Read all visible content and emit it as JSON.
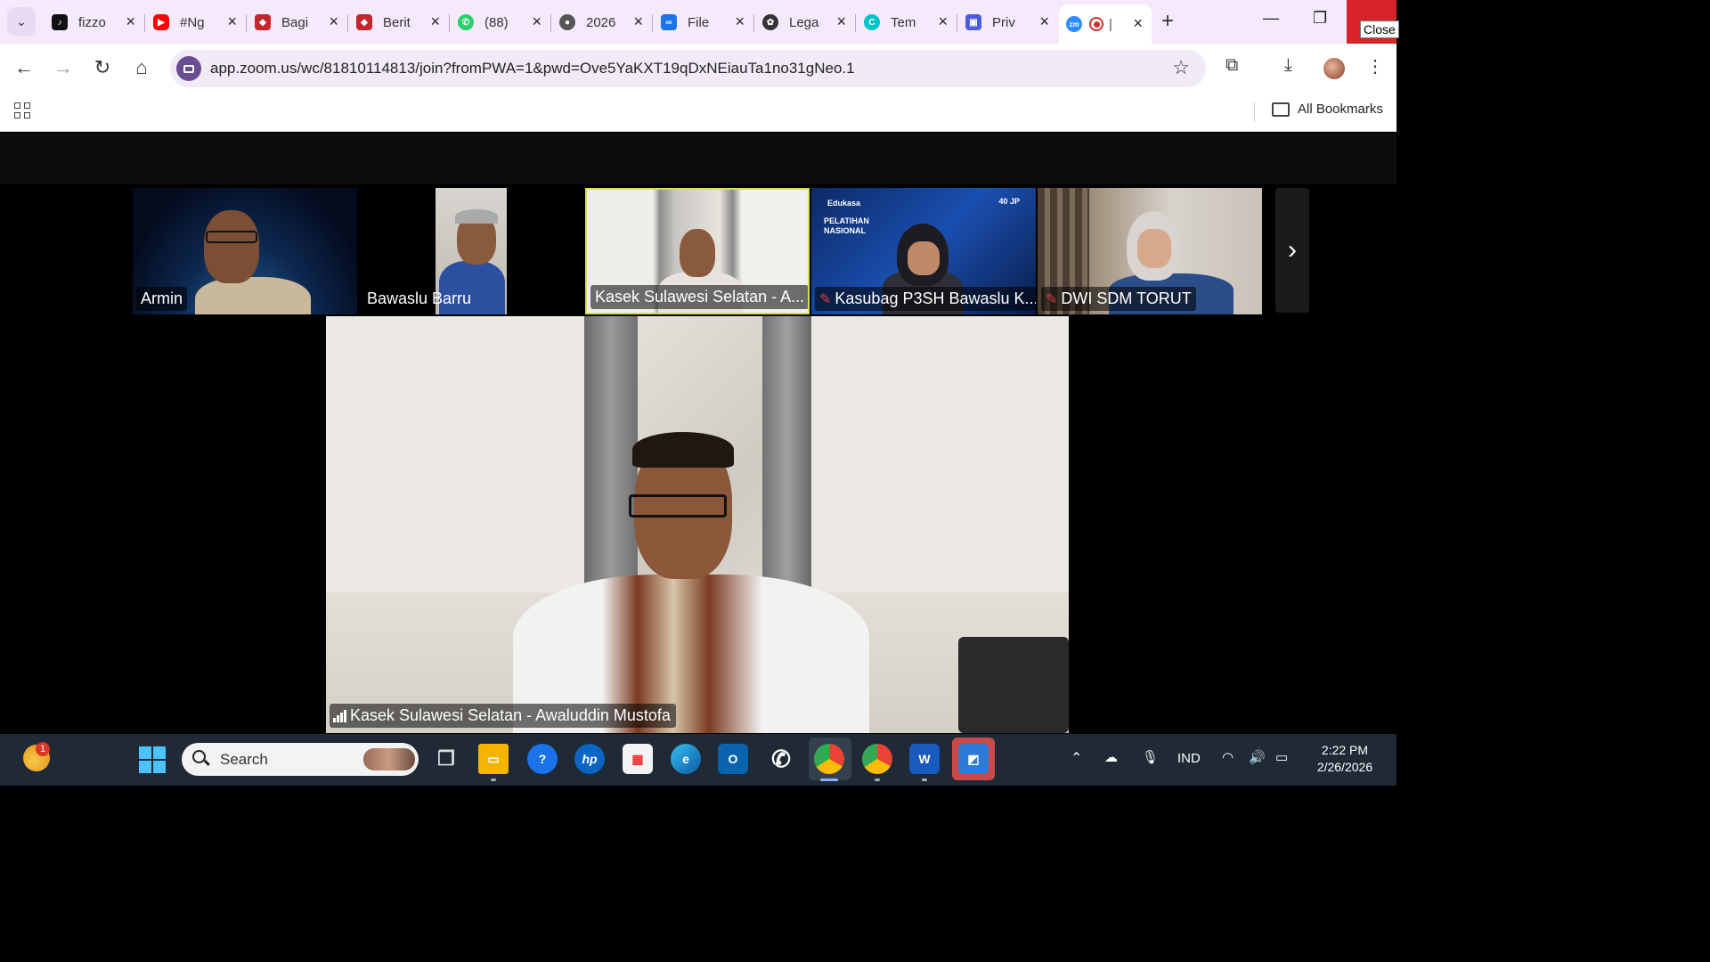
{
  "browser": {
    "tabs": [
      {
        "label": "fizzo",
        "icon": "tiktok-icon",
        "color": "#111111"
      },
      {
        "label": "#Ng",
        "icon": "youtube-icon",
        "color": "#ff0000"
      },
      {
        "label": "Bagi",
        "icon": "cube-icon",
        "color": "#c3262d"
      },
      {
        "label": "Berit",
        "icon": "cube-icon",
        "color": "#c3262d"
      },
      {
        "label": "(88)",
        "icon": "whatsapp-icon",
        "color": "#25d366"
      },
      {
        "label": "2026",
        "icon": "globe-icon",
        "color": "#555555"
      },
      {
        "label": "File",
        "icon": "infinity-icon",
        "color": "#1a73e8"
      },
      {
        "label": "Lega",
        "icon": "openai-icon",
        "color": "#333333"
      },
      {
        "label": "Tem",
        "icon": "canva-icon",
        "color": "#00c4cc"
      },
      {
        "label": "Priv",
        "icon": "chat-icon",
        "color": "#4b5dde"
      },
      {
        "label": "|",
        "icon": "zoom-icon",
        "color": "#2d8cff",
        "active": true
      }
    ],
    "new_tab": "+",
    "close_tooltip": "Close",
    "url": "app.zoom.us/wc/81810114813/join?fromPWA=1&pwd=Ove5YaKXT19qDxNEiauTa1no31gNeo.1",
    "bookmarks_label": "All Bookmarks"
  },
  "meeting": {
    "participants": [
      {
        "name": "Armin",
        "muted": false
      },
      {
        "name": "Bawaslu Barru",
        "muted": false
      },
      {
        "name": "Kasek Sulawesi Selatan - A...",
        "muted": false,
        "speaking": true
      },
      {
        "name": "Kasubag P3SH Bawaslu K...",
        "muted": true
      },
      {
        "name": "DWI SDM TORUT",
        "muted": true
      }
    ],
    "tile_texts": {
      "edukasa": "Edukasa",
      "pelatihan": "PELATIHAN NASIONAL",
      "jp": "40 JP"
    },
    "next_page": "›",
    "main_speaker": "Kasek Sulawesi Selatan - Awaluddin Mustofa"
  },
  "taskbar": {
    "search_label": "Search",
    "weather_badge": "1",
    "language": "IND",
    "time": "2:22 PM",
    "date": "2/26/2026",
    "apps": [
      "task-view",
      "file-explorer",
      "help",
      "hp",
      "microsoft-store",
      "edge",
      "outlook",
      "whatsapp",
      "chrome",
      "chrome-profile",
      "word",
      "remote-desktop"
    ]
  }
}
